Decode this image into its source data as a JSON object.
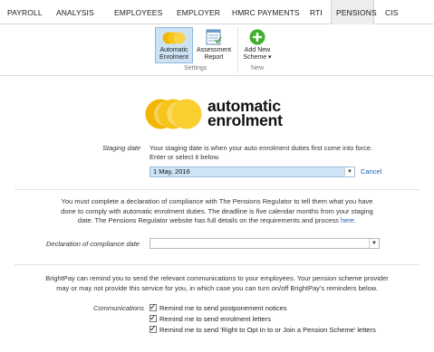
{
  "topnav": {
    "tabs": [
      {
        "label": "PAYROLL"
      },
      {
        "label": "ANALYSIS"
      },
      {
        "label": "EMPLOYEES"
      },
      {
        "label": "EMPLOYER"
      },
      {
        "label": "HMRC PAYMENTS"
      },
      {
        "label": "RTI"
      },
      {
        "label": "PENSIONS"
      },
      {
        "label": "CIS"
      }
    ],
    "active": "PENSIONS"
  },
  "ribbon": {
    "buttons": {
      "auto_enrolment": {
        "line1": "Automatic",
        "line2": "Enrolment",
        "icon": "circles-icon"
      },
      "assessment_report": {
        "line1": "Assessment",
        "line2": "Report",
        "icon": "report-icon"
      },
      "add_new_scheme": {
        "line1": "Add New",
        "line2": "Scheme ▾",
        "icon": "plus-icon"
      }
    },
    "groups": {
      "settings": "Settings",
      "new": "New"
    }
  },
  "logo": {
    "line1": "automatic",
    "line2": "enrolment",
    "color": "#f5c518"
  },
  "staging": {
    "label": "Staging date",
    "help_line1": "Your staging date is when your auto enrolment duties first come into force.",
    "help_line2": "Enter or select it below.",
    "value": "1 May, 2016",
    "cancel": "Cancel"
  },
  "declaration": {
    "para_line1": "You must complete a declaration of compliance with The Pensions Regulator to tell them what you have",
    "para_line2": "done to comply with automatic enrolment duties. The deadline is five calendar months from your staging",
    "para_line3": "date. The Pensions Regulator website has full details on the requirements and process",
    "para_link": "here",
    "para_end": ".",
    "label": "Declaration of compliance date",
    "value": ""
  },
  "communications": {
    "para_line1": "BrightPay can remind you to send the relevant communications to your employees. Your pension scheme provider",
    "para_line2": "may or may not provide this service for you, in which case you can turn on/off BrightPay's reminders below.",
    "label": "Communications",
    "items": [
      {
        "label": "Remind me to send postponement notices",
        "checked": true
      },
      {
        "label": "Remind me to send enrolment letters",
        "checked": true
      },
      {
        "label": "Remind me to send 'Right to Opt In to or Join a Pension Scheme' letters",
        "checked": true
      }
    ]
  }
}
